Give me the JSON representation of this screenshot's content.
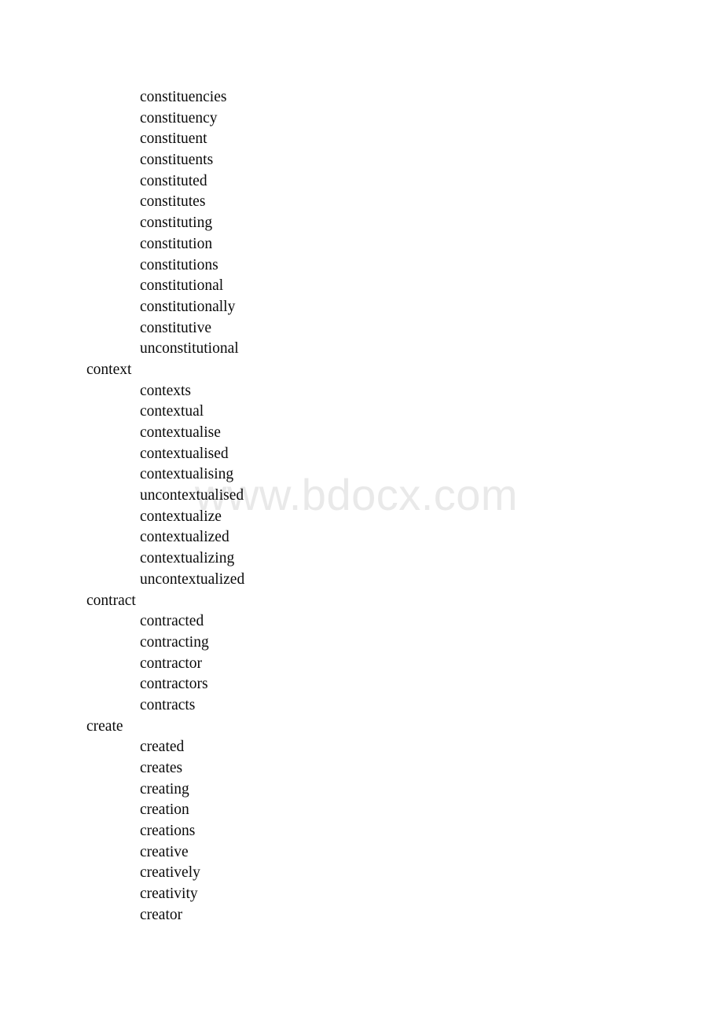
{
  "page": {
    "background_color": "#ffffff",
    "text_color": "#0b0b0b"
  },
  "watermark": {
    "text": "www.bdocx.com",
    "color": "#e9e9e9"
  },
  "word_list": {
    "lines": [
      {
        "text": "constituencies",
        "level": 1
      },
      {
        "text": "constituency",
        "level": 1
      },
      {
        "text": "constituent",
        "level": 1
      },
      {
        "text": "constituents",
        "level": 1
      },
      {
        "text": "constituted",
        "level": 1
      },
      {
        "text": "constitutes",
        "level": 1
      },
      {
        "text": "constituting",
        "level": 1
      },
      {
        "text": "constitution",
        "level": 1
      },
      {
        "text": "constitutions",
        "level": 1
      },
      {
        "text": "constitutional",
        "level": 1
      },
      {
        "text": "constitutionally",
        "level": 1
      },
      {
        "text": "constitutive",
        "level": 1
      },
      {
        "text": "unconstitutional",
        "level": 1
      },
      {
        "text": "context",
        "level": 0
      },
      {
        "text": "contexts",
        "level": 1
      },
      {
        "text": "contextual",
        "level": 1
      },
      {
        "text": "contextualise",
        "level": 1
      },
      {
        "text": "contextualised",
        "level": 1
      },
      {
        "text": "contextualising",
        "level": 1
      },
      {
        "text": "uncontextualised",
        "level": 1
      },
      {
        "text": "contextualize",
        "level": 1
      },
      {
        "text": "contextualized",
        "level": 1
      },
      {
        "text": "contextualizing",
        "level": 1
      },
      {
        "text": "uncontextualized",
        "level": 1
      },
      {
        "text": "contract",
        "level": 0
      },
      {
        "text": "contracted",
        "level": 1
      },
      {
        "text": "contracting",
        "level": 1
      },
      {
        "text": "contractor",
        "level": 1
      },
      {
        "text": "contractors",
        "level": 1
      },
      {
        "text": "contracts",
        "level": 1
      },
      {
        "text": "create",
        "level": 0
      },
      {
        "text": "created",
        "level": 1
      },
      {
        "text": "creates",
        "level": 1
      },
      {
        "text": "creating",
        "level": 1
      },
      {
        "text": "creation",
        "level": 1
      },
      {
        "text": "creations",
        "level": 1
      },
      {
        "text": "creative",
        "level": 1
      },
      {
        "text": "creatively",
        "level": 1
      },
      {
        "text": "creativity",
        "level": 1
      },
      {
        "text": "creator",
        "level": 1
      }
    ]
  }
}
